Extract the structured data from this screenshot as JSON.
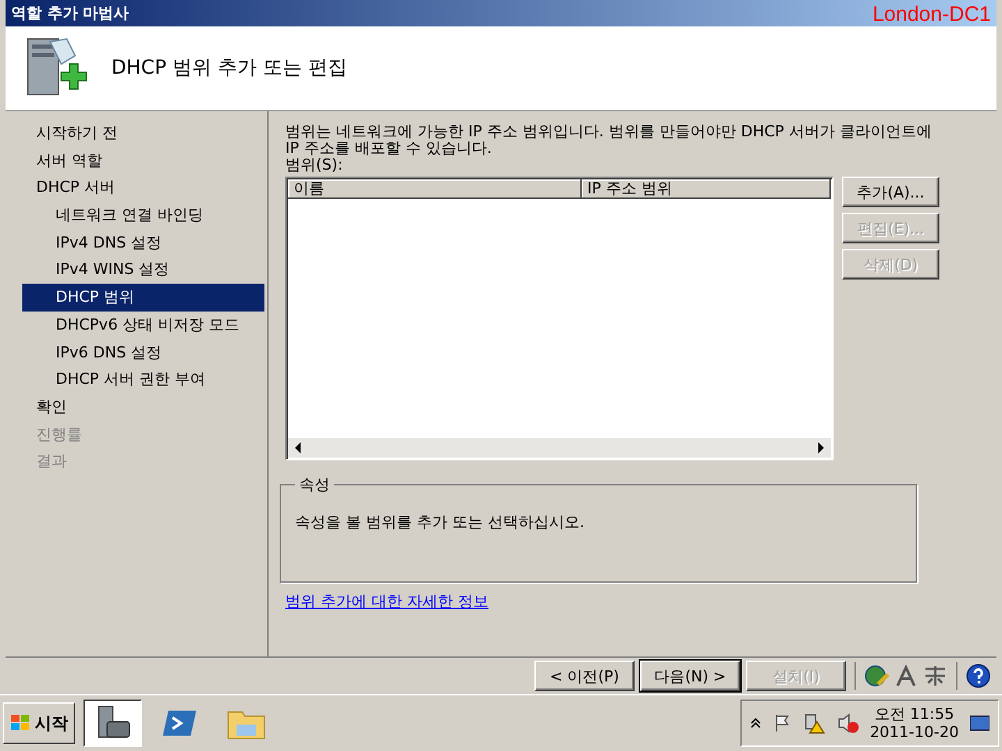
{
  "window": {
    "title": "역할 추가 마법사",
    "overlay_label": "London-DC1"
  },
  "header": {
    "title": "DHCP 범위 추가 또는 편집"
  },
  "nav": [
    {
      "label": "시작하기 전",
      "selected": false,
      "disabled": false
    },
    {
      "label": "서버 역할",
      "selected": false,
      "disabled": false
    },
    {
      "label": "DHCP 서버",
      "selected": false,
      "disabled": false,
      "children": [
        {
          "label": "네트워크 연결 바인딩",
          "selected": false,
          "disabled": false
        },
        {
          "label": "IPv4 DNS 설정",
          "selected": false,
          "disabled": false
        },
        {
          "label": "IPv4 WINS 설정",
          "selected": false,
          "disabled": false
        },
        {
          "label": "DHCP 범위",
          "selected": true,
          "disabled": false
        },
        {
          "label": "DHCPv6 상태 비저장 모드",
          "selected": false,
          "disabled": false
        },
        {
          "label": "IPv6 DNS 설정",
          "selected": false,
          "disabled": false
        },
        {
          "label": "DHCP 서버 권한 부여",
          "selected": false,
          "disabled": false
        }
      ]
    },
    {
      "label": "확인",
      "selected": false,
      "disabled": false
    },
    {
      "label": "진행률",
      "selected": false,
      "disabled": true
    },
    {
      "label": "결과",
      "selected": false,
      "disabled": true
    }
  ],
  "content": {
    "description": "범위는 네트워크에 가능한 IP 주소 범위입니다. 범위를 만들어야만 DHCP 서버가 클라이언트에 IP 주소를 배포할 수 있습니다.",
    "list_label": "범위(S):",
    "table": {
      "columns": [
        "이름",
        "IP 주소 범위"
      ]
    },
    "side_buttons": [
      {
        "label": "추가(A)...",
        "disabled": false
      },
      {
        "label": "편집(E)...",
        "disabled": true
      },
      {
        "label": "삭제(D)",
        "disabled": true
      }
    ],
    "properties": {
      "title": "속성",
      "text": "속성을 볼 범위를 추가 또는 선택하십시오."
    },
    "link": "범위 추가에 대한 자세한 정보"
  },
  "footer_buttons": [
    {
      "label": "< 이전(P)",
      "disabled": false,
      "default": false
    },
    {
      "label": "다음(N) >",
      "disabled": false,
      "default": true
    },
    {
      "label": "설치(I)",
      "disabled": true,
      "default": false
    }
  ],
  "taskbar": {
    "start": "시작",
    "clock_time": "오전 11:55",
    "clock_date": "2011-10-20"
  }
}
